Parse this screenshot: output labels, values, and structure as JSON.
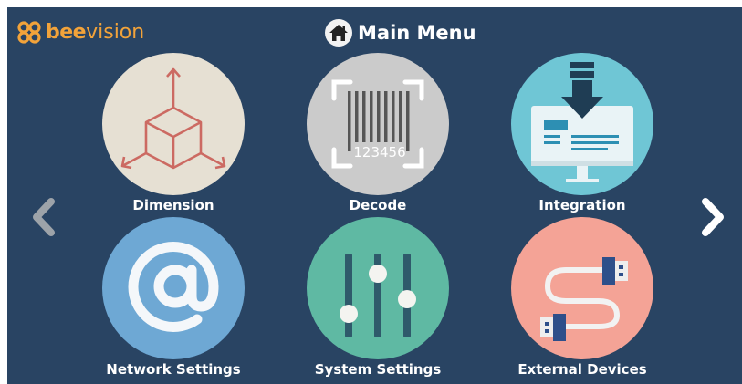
{
  "header": {
    "logo_bee": "bee",
    "logo_vision": "vision",
    "title": "Main Menu",
    "brand_color": "#f2a33a",
    "background_color": "#294463"
  },
  "menu": [
    {
      "label": "Dimension",
      "icon": "cube-dimension-icon",
      "color": "#e6e0d3"
    },
    {
      "label": "Decode",
      "icon": "barcode-icon",
      "color": "#cbcbcb",
      "barcode_text": "123456"
    },
    {
      "label": "Integration",
      "icon": "monitor-download-icon",
      "color": "#6fc6d5"
    },
    {
      "label": "Network Settings",
      "icon": "at-sign-icon",
      "color": "#6ea8d4"
    },
    {
      "label": "System Settings",
      "icon": "sliders-icon",
      "color": "#5fb9a3"
    },
    {
      "label": "External Devices",
      "icon": "usb-cable-icon",
      "color": "#f4a396"
    }
  ],
  "navigation": {
    "prev": "chevron-left-icon",
    "next": "chevron-right-icon"
  }
}
